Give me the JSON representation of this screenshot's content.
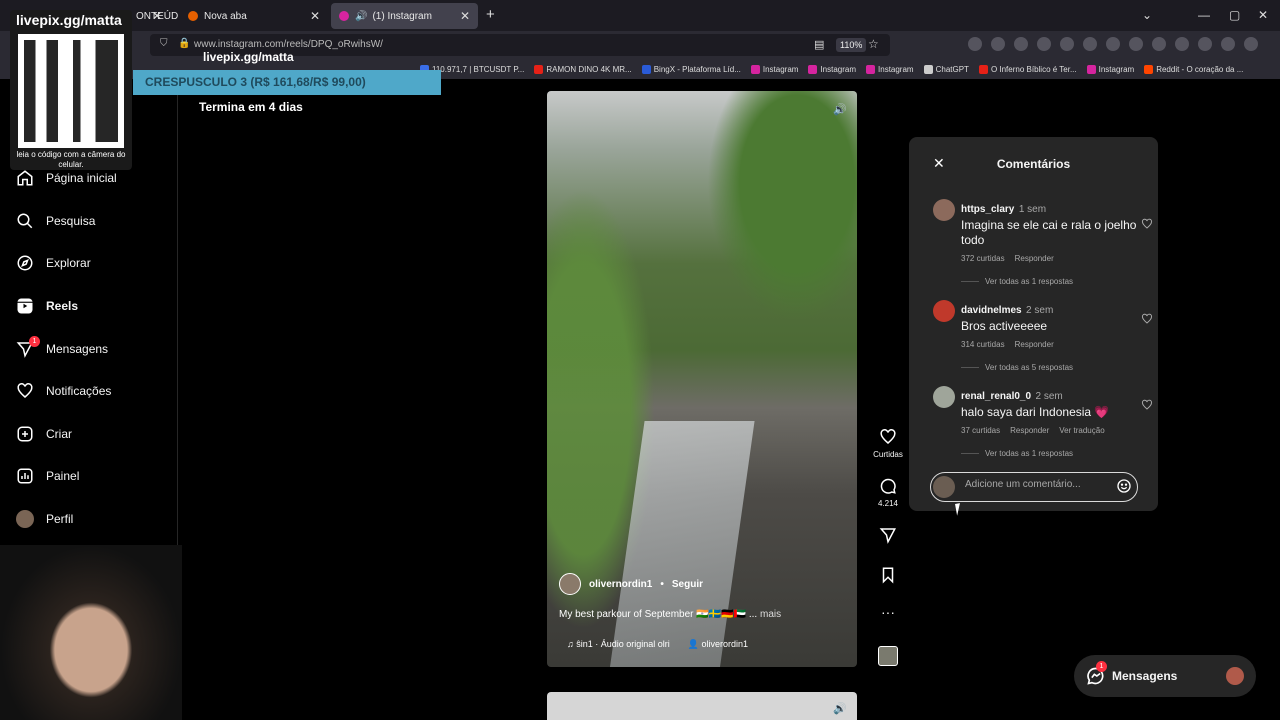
{
  "browser": {
    "tabs": [
      {
        "label": "ONTEÚD",
        "active": false
      },
      {
        "label": "Nova aba",
        "active": false
      },
      {
        "label": "(1) Instagram",
        "active": true
      }
    ],
    "url": "www.instagram.com/reels/DPQ_oRwihsW/",
    "zoom": "110%",
    "bookmarks": [
      "110.971,7 | BTCUSDT P...",
      "RAMON DINO 4K MR...",
      "BingX - Plataforma Líd...",
      "Instagram",
      "Instagram",
      "Instagram",
      "ChatGPT",
      "O Inferno Bíblico é Ter...",
      "Instagram",
      "Reddit - O coração da ..."
    ]
  },
  "stream": {
    "qr_title": "livepix.gg/matta",
    "qr_caption": "leia o código com a câmera do celular.",
    "overlay_title": "livepix.gg/matta",
    "promo": "CRESPUSCULO 3 (R$ 161,68/R$ 99,00)",
    "expiry": "Termina em 4 dias"
  },
  "sidebar": {
    "items": [
      {
        "label": "Página inicial",
        "icon": "home-icon"
      },
      {
        "label": "Pesquisa",
        "icon": "search-icon"
      },
      {
        "label": "Explorar",
        "icon": "compass-icon"
      },
      {
        "label": "Reels",
        "icon": "reels-icon"
      },
      {
        "label": "Mensagens",
        "icon": "messages-icon",
        "badge": "1"
      },
      {
        "label": "Notificações",
        "icon": "heart-icon"
      },
      {
        "label": "Criar",
        "icon": "plus-square-icon"
      },
      {
        "label": "Painel",
        "icon": "dashboard-icon"
      },
      {
        "label": "Perfil",
        "icon": "avatar"
      }
    ]
  },
  "reel": {
    "author": "olivernordin1",
    "follow": "Seguir",
    "separator": "•",
    "caption": "My best parkour of September 🇮🇳🇸🇪🇩🇪🇦🇪 ...",
    "more": "mais",
    "audio": "♫ ŝin1 · Áudio original  olri",
    "tagged_user": "oliverordin1"
  },
  "actions": {
    "likes_label": "Curtidas",
    "comments_count": "4.214"
  },
  "comments": {
    "title": "Comentários",
    "items": [
      {
        "user": "https_clary",
        "time": "1 sem",
        "text": "Imagina se ele cai e rala o joelho todo",
        "likes": "372 curtidas",
        "reply": "Responder",
        "translate": "",
        "replies": "Ver todas as 1 respostas",
        "avatar_color": "#8c6a5c"
      },
      {
        "user": "davidnelmes",
        "time": "2 sem",
        "text": "Bros activeeeee",
        "likes": "314 curtidas",
        "reply": "Responder",
        "translate": "",
        "replies": "Ver todas as 5 respostas",
        "avatar_color": "#c0392b"
      },
      {
        "user": "renal_renal0_0",
        "time": "2 sem",
        "text": "halo saya dari Indonesia 💗",
        "likes": "37 curtidas",
        "reply": "Responder",
        "translate": "Ver tradução",
        "replies": "Ver todas as 1 respostas",
        "avatar_color": "#9fa59a"
      }
    ],
    "placeholder": "Adicione um comentário..."
  },
  "messages_pill": {
    "label": "Mensagens",
    "badge": "1"
  }
}
